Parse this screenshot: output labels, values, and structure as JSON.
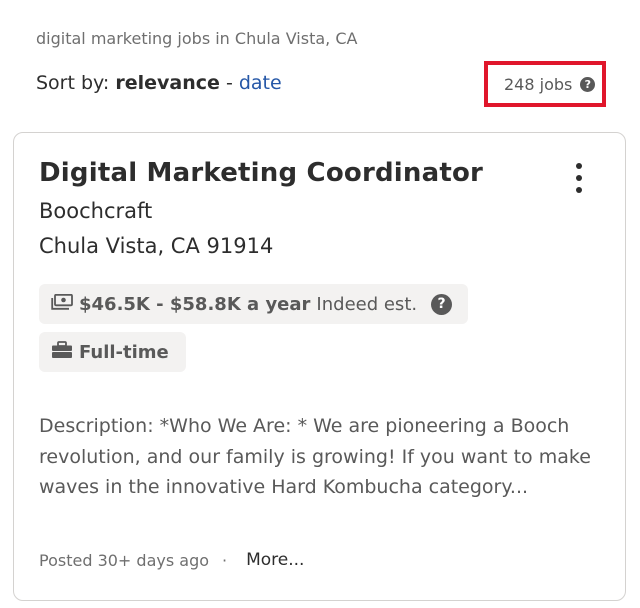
{
  "search": {
    "query_text": "digital marketing jobs in Chula Vista, CA",
    "sort_label": "Sort by:",
    "sort_selected": "relevance",
    "sort_separator": " - ",
    "sort_alternative": "date",
    "job_count": "248 jobs",
    "help_glyph": "?"
  },
  "job": {
    "title": "Digital Marketing Coordinator",
    "company": "Boochcraft",
    "location": "Chula Vista, CA 91914",
    "salary": "$46.5K - $58.8K a year",
    "salary_note": "Indeed est.",
    "job_type": "Full-time",
    "description": "Description: *Who We Are: * We are pioneering a Booch revolution, and our family is growing! If you want to make waves in the innovative Hard Kombucha category...",
    "posted": "Posted 30+ days ago",
    "dot_separator": "·",
    "more_link": "More..."
  },
  "icons": {
    "help": "help-icon",
    "kebab": "more-options-icon",
    "salary": "money-icon",
    "job_type": "briefcase-icon"
  },
  "colors": {
    "link": "#2557a7",
    "highlight_border": "#e0162b",
    "chip_background": "#f3f2f1",
    "text_primary": "#2d2d2d",
    "text_secondary": "#595959"
  }
}
